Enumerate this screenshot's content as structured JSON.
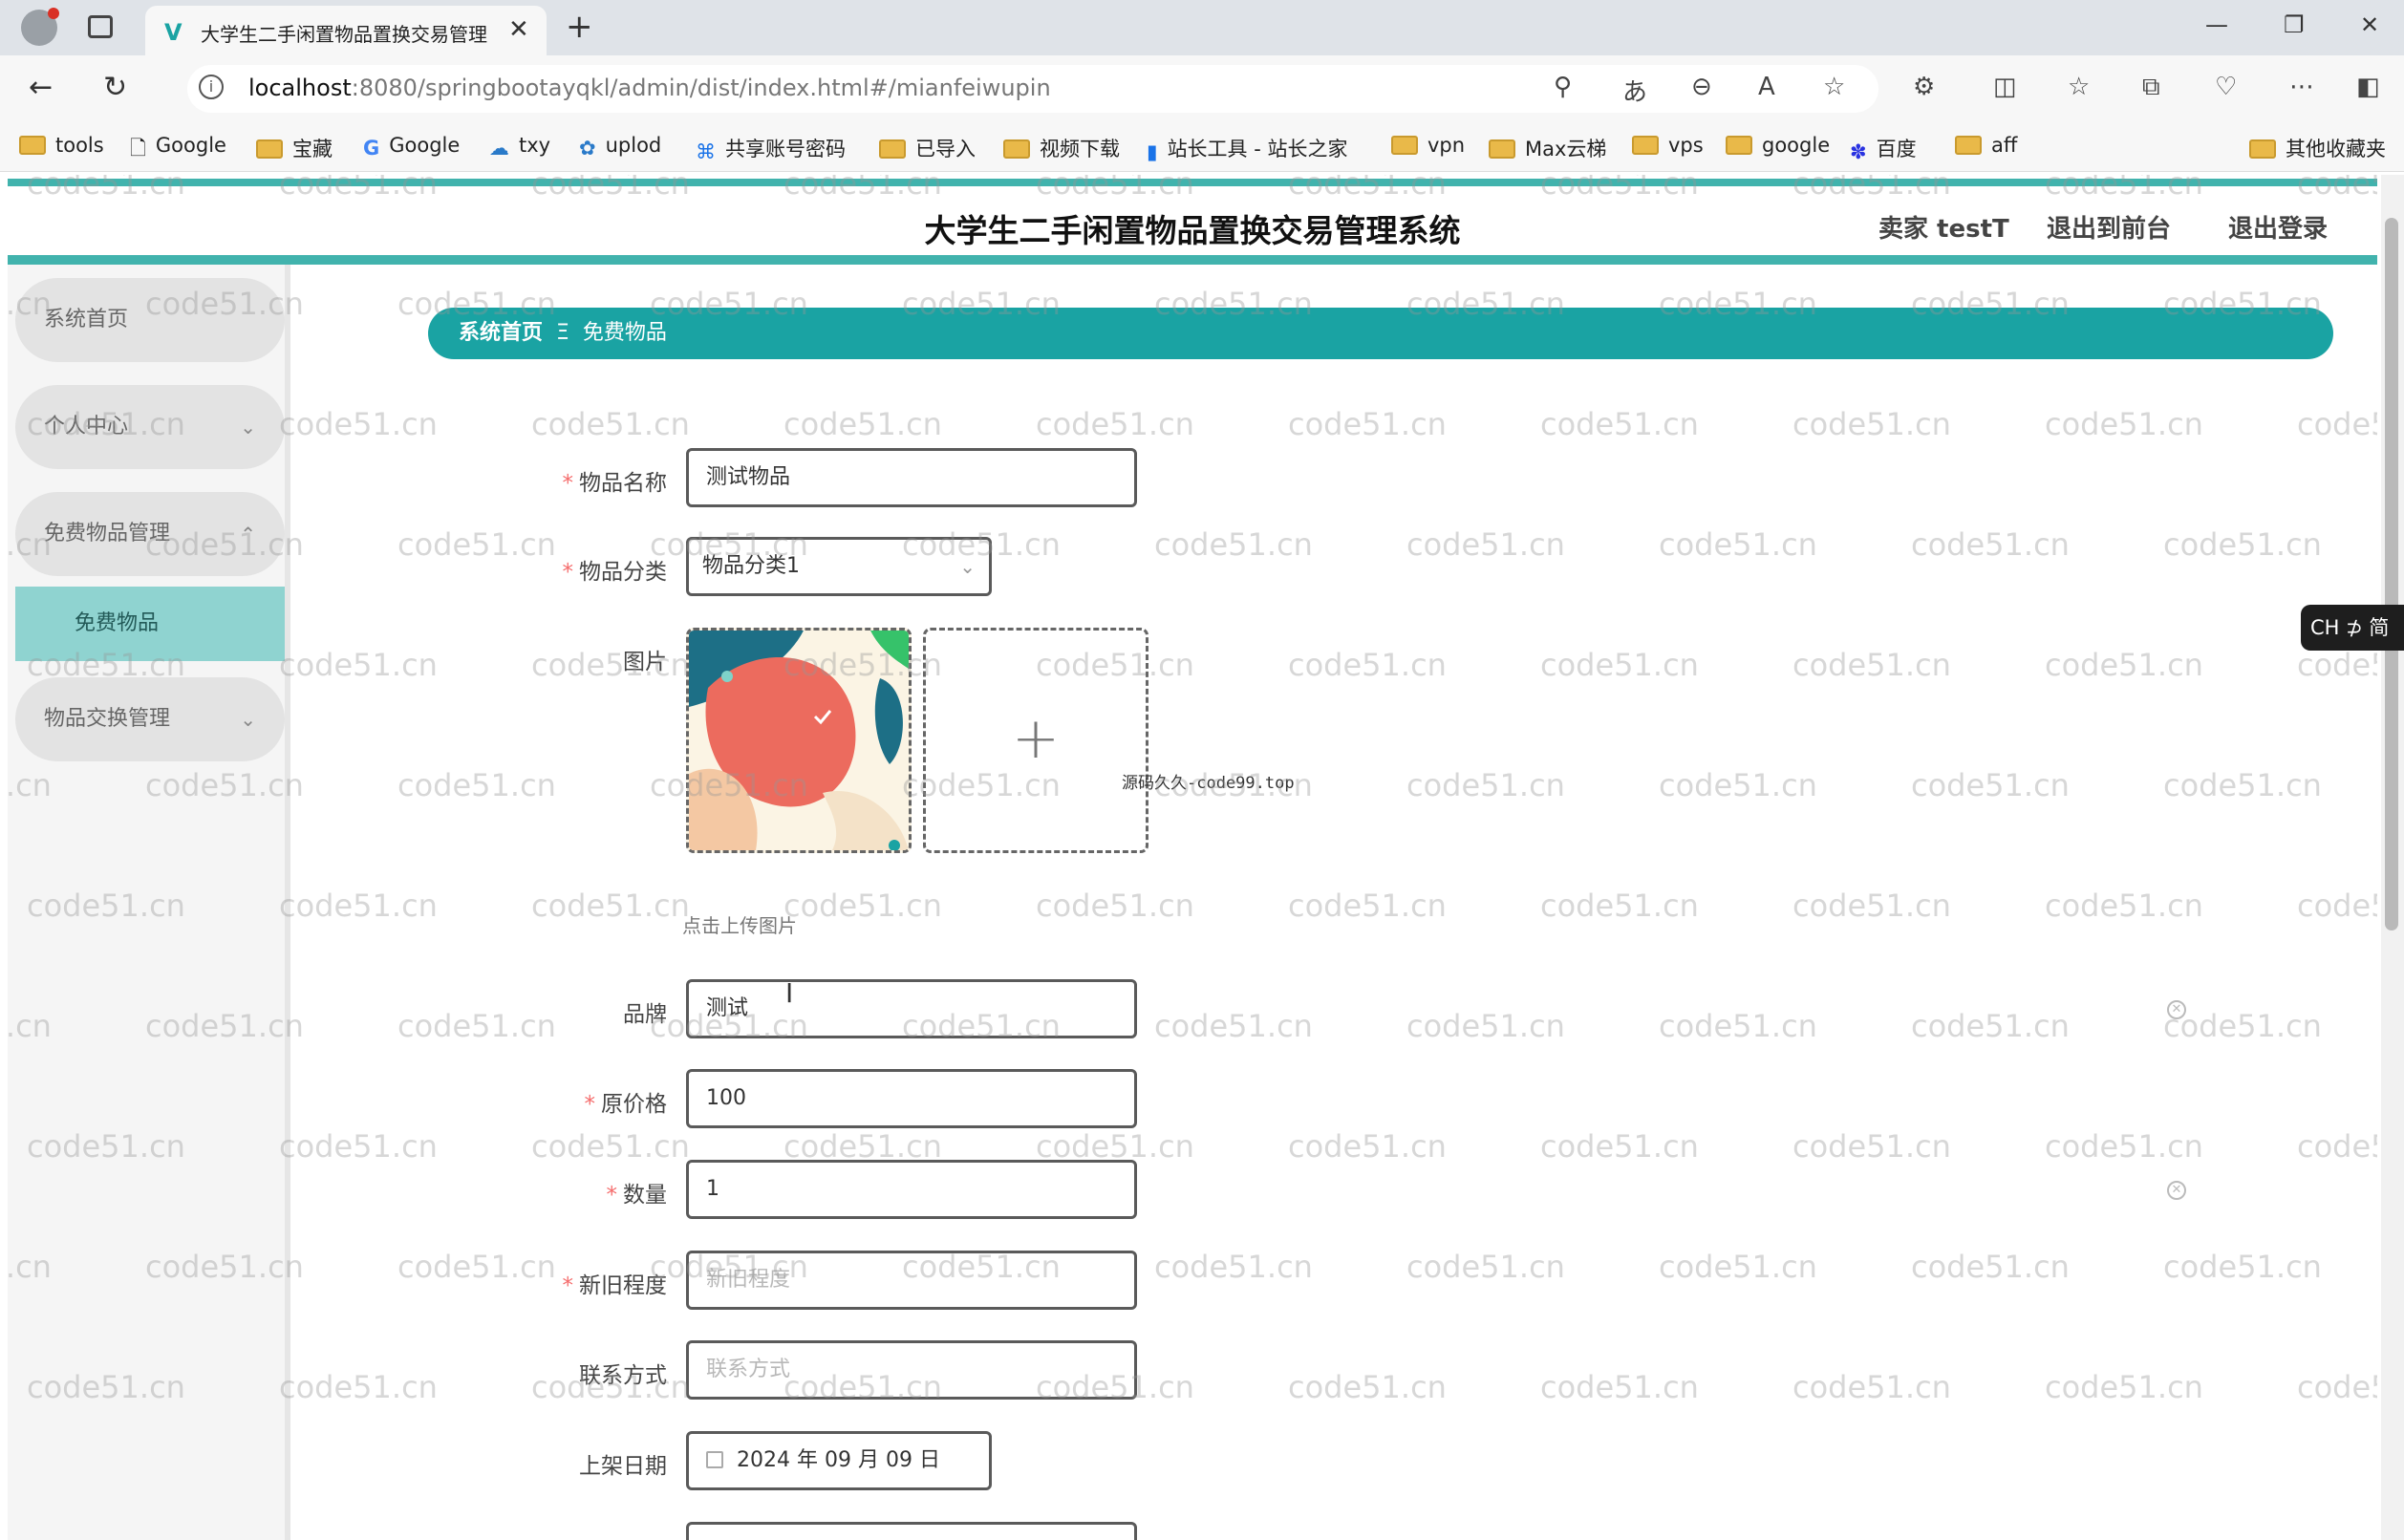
{
  "browser": {
    "tab_title": "大学生二手闲置物品置换交易管理",
    "url_host": "localhost",
    "url_rest": ":8080/springbootayqkl/admin/dist/index.html#/mianfeiwupin",
    "bookmarks": [
      "tools",
      "Google",
      "宝藏",
      "Google",
      "txy",
      "uplod",
      "共享账号密码",
      "已导入",
      "视频下载",
      "站长工具 - 站长之家",
      "vpn",
      "Max云梯",
      "vps",
      "google",
      "百度",
      "aff"
    ],
    "other_bookmarks": "其他收藏夹"
  },
  "header": {
    "title": "大学生二手闲置物品置换交易管理系统",
    "user": "卖家 testT",
    "front_link": "退出到前台",
    "logout": "退出登录"
  },
  "sidebar": {
    "items": [
      {
        "label": "系统首页"
      },
      {
        "label": "个人中心",
        "caret": "⌄"
      },
      {
        "label": "免费物品管理",
        "caret": "⌃"
      },
      {
        "label": "物品交换管理",
        "caret": "⌄"
      }
    ],
    "sub_item": "免费物品"
  },
  "breadcrumb": {
    "home": "系统首页",
    "sep": "Ξ",
    "current": "免费物品"
  },
  "form": {
    "name_label": "物品名称",
    "name_value": "测试物品",
    "category_label": "物品分类",
    "category_value": "物品分类1",
    "image_label": "图片",
    "upload_tip": "点击上传图片",
    "brand_label": "品牌",
    "brand_value": "测试",
    "price_label": "原价格",
    "price_value": "100",
    "qty_label": "数量",
    "qty_value": "1",
    "condition_label": "新旧程度",
    "condition_placeholder": "新旧程度",
    "contact_label": "联系方式",
    "contact_placeholder": "联系方式",
    "date_label": "上架日期",
    "date_value": "2024 年 09 月 09 日"
  },
  "overlay": {
    "source_note": "源码久久-code99.top",
    "ime": "CH ⊅ 简",
    "watermark": "code51.cn"
  }
}
